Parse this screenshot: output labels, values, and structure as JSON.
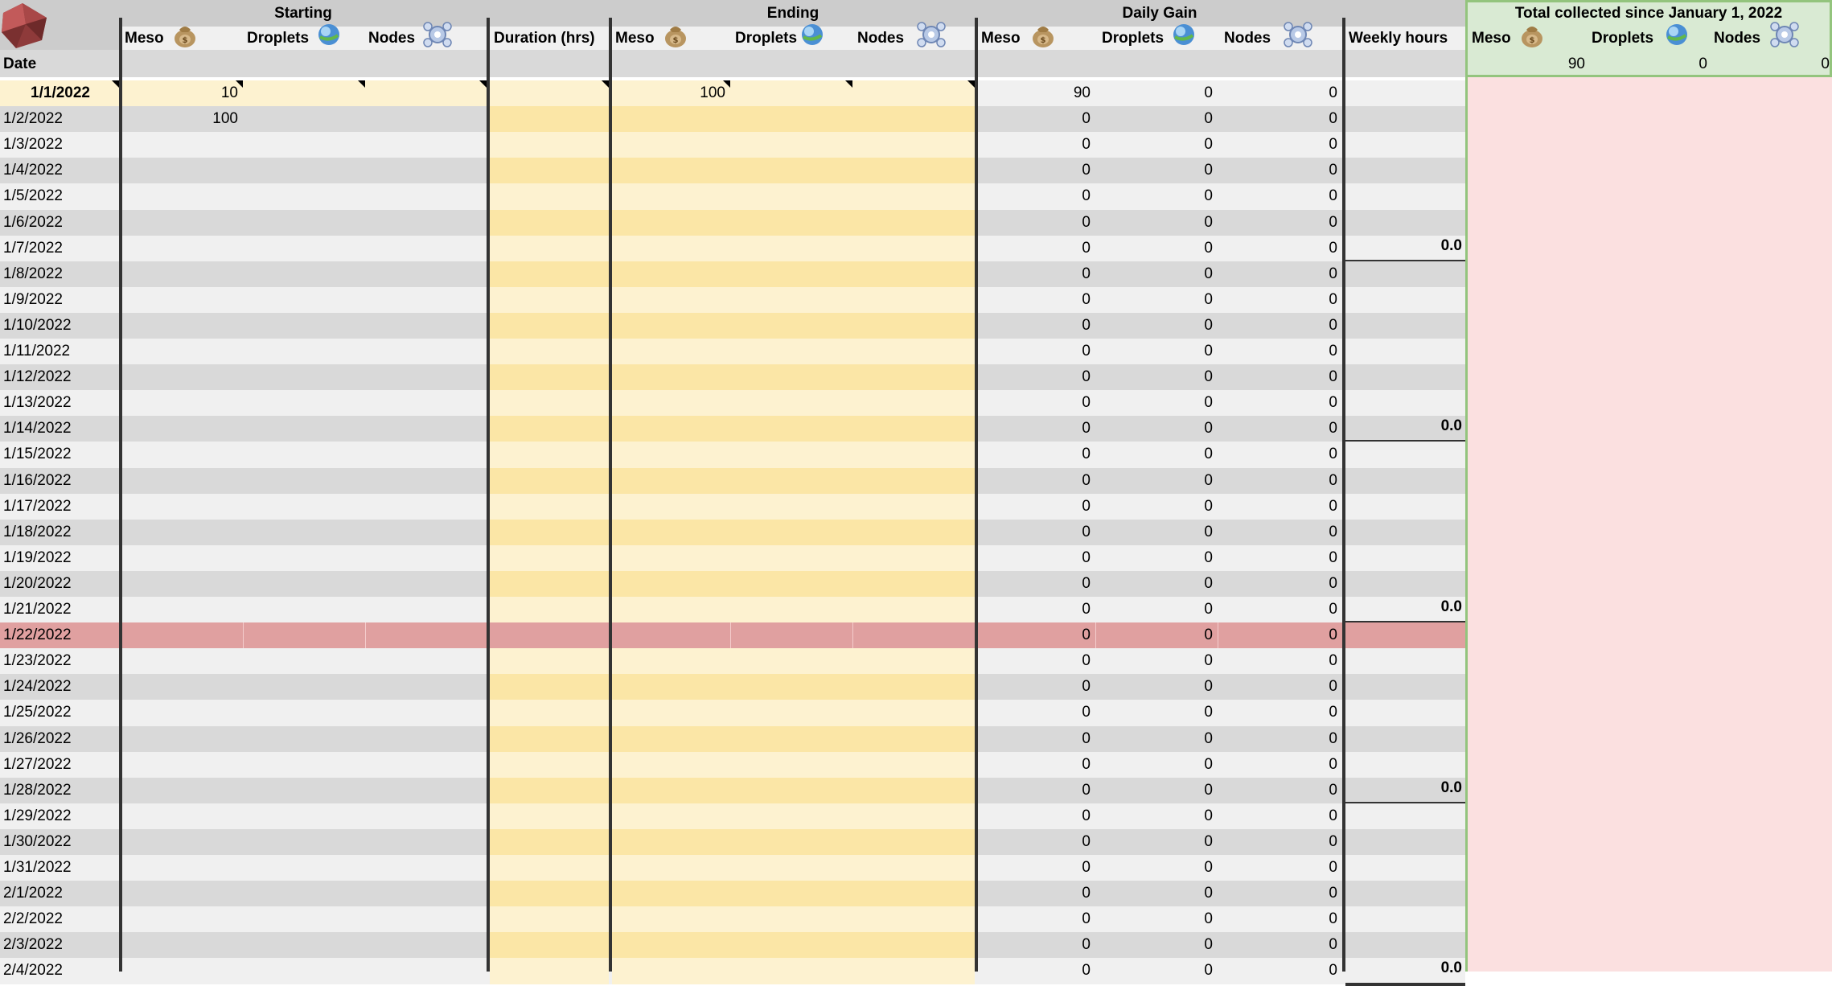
{
  "headers": {
    "starting": "Starting",
    "ending": "Ending",
    "daily_gain": "Daily Gain",
    "total": "Total collected since January 1, 2022"
  },
  "subheaders": {
    "meso": "Meso",
    "droplets": "Droplets",
    "nodes": "Nodes",
    "duration": "Duration (hrs)",
    "weekly_hours": "Weekly hours",
    "date": "Date"
  },
  "icons": {
    "logo": "red-crystal-logo-icon",
    "meso": "meso-bag-icon",
    "droplets": "droplet-orb-icon",
    "nodes": "node-cluster-icon"
  },
  "colors": {
    "header_bar": "#cccccc",
    "subheader": "#f0f0f0",
    "row_light": "#f0f0f0",
    "row_dark": "#d9d9d9",
    "input_light": "#fdf2d0",
    "input_dark": "#fbe6a6",
    "highlight_row": "#e0a0a0",
    "total_header_bg": "#d9ead3",
    "total_border": "#93c47d",
    "total_body": "#fbe0e0",
    "divider": "#333333"
  },
  "totals": {
    "meso": "90",
    "droplets": "0",
    "nodes": "0"
  },
  "highlight_date": "1/22/2022",
  "rows": [
    {
      "date": "1/1/2022",
      "start_meso": "10",
      "end_meso": "100",
      "gain_meso": "90",
      "gain_droplets": "0",
      "gain_nodes": "0",
      "weekly": ""
    },
    {
      "date": "1/2/2022",
      "start_meso": "100",
      "end_meso": "",
      "gain_meso": "0",
      "gain_droplets": "0",
      "gain_nodes": "0",
      "weekly": ""
    },
    {
      "date": "1/3/2022",
      "start_meso": "",
      "end_meso": "",
      "gain_meso": "0",
      "gain_droplets": "0",
      "gain_nodes": "0",
      "weekly": ""
    },
    {
      "date": "1/4/2022",
      "start_meso": "",
      "end_meso": "",
      "gain_meso": "0",
      "gain_droplets": "0",
      "gain_nodes": "0",
      "weekly": ""
    },
    {
      "date": "1/5/2022",
      "start_meso": "",
      "end_meso": "",
      "gain_meso": "0",
      "gain_droplets": "0",
      "gain_nodes": "0",
      "weekly": ""
    },
    {
      "date": "1/6/2022",
      "start_meso": "",
      "end_meso": "",
      "gain_meso": "0",
      "gain_droplets": "0",
      "gain_nodes": "0",
      "weekly": ""
    },
    {
      "date": "1/7/2022",
      "start_meso": "",
      "end_meso": "",
      "gain_meso": "0",
      "gain_droplets": "0",
      "gain_nodes": "0",
      "weekly": "0.0"
    },
    {
      "date": "1/8/2022",
      "start_meso": "",
      "end_meso": "",
      "gain_meso": "0",
      "gain_droplets": "0",
      "gain_nodes": "0",
      "weekly": ""
    },
    {
      "date": "1/9/2022",
      "start_meso": "",
      "end_meso": "",
      "gain_meso": "0",
      "gain_droplets": "0",
      "gain_nodes": "0",
      "weekly": ""
    },
    {
      "date": "1/10/2022",
      "start_meso": "",
      "end_meso": "",
      "gain_meso": "0",
      "gain_droplets": "0",
      "gain_nodes": "0",
      "weekly": ""
    },
    {
      "date": "1/11/2022",
      "start_meso": "",
      "end_meso": "",
      "gain_meso": "0",
      "gain_droplets": "0",
      "gain_nodes": "0",
      "weekly": ""
    },
    {
      "date": "1/12/2022",
      "start_meso": "",
      "end_meso": "",
      "gain_meso": "0",
      "gain_droplets": "0",
      "gain_nodes": "0",
      "weekly": ""
    },
    {
      "date": "1/13/2022",
      "start_meso": "",
      "end_meso": "",
      "gain_meso": "0",
      "gain_droplets": "0",
      "gain_nodes": "0",
      "weekly": ""
    },
    {
      "date": "1/14/2022",
      "start_meso": "",
      "end_meso": "",
      "gain_meso": "0",
      "gain_droplets": "0",
      "gain_nodes": "0",
      "weekly": "0.0"
    },
    {
      "date": "1/15/2022",
      "start_meso": "",
      "end_meso": "",
      "gain_meso": "0",
      "gain_droplets": "0",
      "gain_nodes": "0",
      "weekly": ""
    },
    {
      "date": "1/16/2022",
      "start_meso": "",
      "end_meso": "",
      "gain_meso": "0",
      "gain_droplets": "0",
      "gain_nodes": "0",
      "weekly": ""
    },
    {
      "date": "1/17/2022",
      "start_meso": "",
      "end_meso": "",
      "gain_meso": "0",
      "gain_droplets": "0",
      "gain_nodes": "0",
      "weekly": ""
    },
    {
      "date": "1/18/2022",
      "start_meso": "",
      "end_meso": "",
      "gain_meso": "0",
      "gain_droplets": "0",
      "gain_nodes": "0",
      "weekly": ""
    },
    {
      "date": "1/19/2022",
      "start_meso": "",
      "end_meso": "",
      "gain_meso": "0",
      "gain_droplets": "0",
      "gain_nodes": "0",
      "weekly": ""
    },
    {
      "date": "1/20/2022",
      "start_meso": "",
      "end_meso": "",
      "gain_meso": "0",
      "gain_droplets": "0",
      "gain_nodes": "0",
      "weekly": ""
    },
    {
      "date": "1/21/2022",
      "start_meso": "",
      "end_meso": "",
      "gain_meso": "0",
      "gain_droplets": "0",
      "gain_nodes": "0",
      "weekly": "0.0"
    },
    {
      "date": "1/22/2022",
      "start_meso": "",
      "end_meso": "",
      "gain_meso": "0",
      "gain_droplets": "0",
      "gain_nodes": "0",
      "weekly": ""
    },
    {
      "date": "1/23/2022",
      "start_meso": "",
      "end_meso": "",
      "gain_meso": "0",
      "gain_droplets": "0",
      "gain_nodes": "0",
      "weekly": ""
    },
    {
      "date": "1/24/2022",
      "start_meso": "",
      "end_meso": "",
      "gain_meso": "0",
      "gain_droplets": "0",
      "gain_nodes": "0",
      "weekly": ""
    },
    {
      "date": "1/25/2022",
      "start_meso": "",
      "end_meso": "",
      "gain_meso": "0",
      "gain_droplets": "0",
      "gain_nodes": "0",
      "weekly": ""
    },
    {
      "date": "1/26/2022",
      "start_meso": "",
      "end_meso": "",
      "gain_meso": "0",
      "gain_droplets": "0",
      "gain_nodes": "0",
      "weekly": ""
    },
    {
      "date": "1/27/2022",
      "start_meso": "",
      "end_meso": "",
      "gain_meso": "0",
      "gain_droplets": "0",
      "gain_nodes": "0",
      "weekly": ""
    },
    {
      "date": "1/28/2022",
      "start_meso": "",
      "end_meso": "",
      "gain_meso": "0",
      "gain_droplets": "0",
      "gain_nodes": "0",
      "weekly": "0.0"
    },
    {
      "date": "1/29/2022",
      "start_meso": "",
      "end_meso": "",
      "gain_meso": "0",
      "gain_droplets": "0",
      "gain_nodes": "0",
      "weekly": ""
    },
    {
      "date": "1/30/2022",
      "start_meso": "",
      "end_meso": "",
      "gain_meso": "0",
      "gain_droplets": "0",
      "gain_nodes": "0",
      "weekly": ""
    },
    {
      "date": "1/31/2022",
      "start_meso": "",
      "end_meso": "",
      "gain_meso": "0",
      "gain_droplets": "0",
      "gain_nodes": "0",
      "weekly": ""
    },
    {
      "date": "2/1/2022",
      "start_meso": "",
      "end_meso": "",
      "gain_meso": "0",
      "gain_droplets": "0",
      "gain_nodes": "0",
      "weekly": ""
    },
    {
      "date": "2/2/2022",
      "start_meso": "",
      "end_meso": "",
      "gain_meso": "0",
      "gain_droplets": "0",
      "gain_nodes": "0",
      "weekly": ""
    },
    {
      "date": "2/3/2022",
      "start_meso": "",
      "end_meso": "",
      "gain_meso": "0",
      "gain_droplets": "0",
      "gain_nodes": "0",
      "weekly": ""
    },
    {
      "date": "2/4/2022",
      "start_meso": "",
      "end_meso": "",
      "gain_meso": "0",
      "gain_droplets": "0",
      "gain_nodes": "0",
      "weekly": "0.0"
    }
  ]
}
